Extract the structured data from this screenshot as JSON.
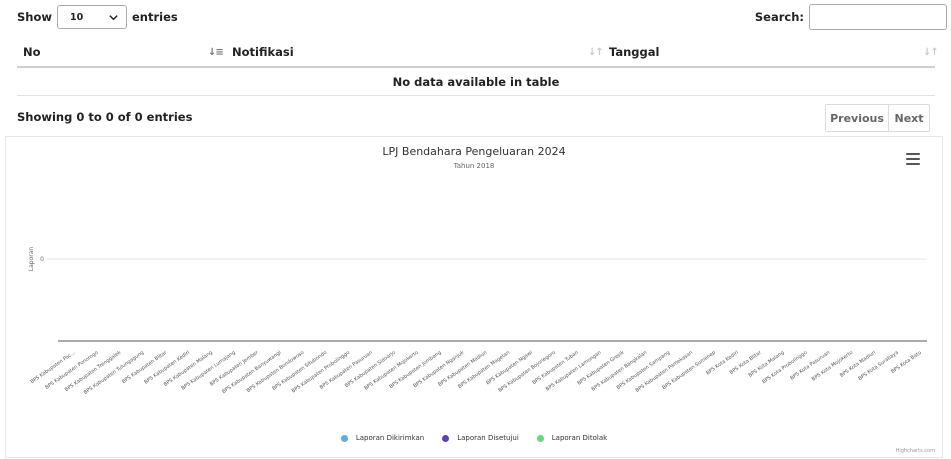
{
  "length_menu": {
    "show_label": "Show",
    "selected": "10",
    "entries_label": "entries"
  },
  "search": {
    "label": "Search:",
    "value": ""
  },
  "table": {
    "columns": [
      "No",
      "Notifikasi",
      "Tanggal"
    ],
    "empty_message": "No data available in table"
  },
  "info": "Showing 0 to 0 of 0 entries",
  "pagination": {
    "previous": "Previous",
    "next": "Next"
  },
  "chart_data": {
    "type": "bar",
    "title": "LPJ Bendahara Pengeluaran 2024",
    "subtitle": "Tahun 2018",
    "ylabel": "Laporan",
    "y_ticks": [
      "0"
    ],
    "categories": [
      "BPS Kabupaten Pac...",
      "BPS Kabupaten Ponorogo",
      "BPS Kabupaten Trenggalek",
      "BPS Kabupaten Tulungagung",
      "BPS Kabupaten Blitar",
      "BPS Kabupaten Kediri",
      "BPS Kabupaten Malang",
      "BPS Kabupaten Lumajang",
      "BPS Kabupaten Jember",
      "BPS Kabupaten Banyuwangi",
      "BPS Kabupaten Bondowoso",
      "BPS Kabupaten Situbondo",
      "BPS Kabupaten Probolinggo",
      "BPS Kabupaten Pasuruan",
      "BPS Kabupaten Sidoarjo",
      "BPS Kabupaten Mojokerto",
      "BPS Kabupaten Jombang",
      "BPS Kabupaten Nganjuk",
      "BPS Kabupaten Madiun",
      "BPS Kabupaten Magetan",
      "BPS Kabupaten Ngawi",
      "BPS Kabupaten Bojonegoro",
      "BPS Kabupaten Tuban",
      "BPS Kabupaten Lamongan",
      "BPS Kabupaten Gresik",
      "BPS Kabupaten Bangkalan",
      "BPS Kabupaten Sampang",
      "BPS Kabupaten Pamekasan",
      "BPS Kabupaten Sumenep",
      "BPS Kota Kediri",
      "BPS Kota Blitar",
      "BPS Kota Malang",
      "BPS Kota Probolinggo",
      "BPS Kota Pasuruan",
      "BPS Kota Mojokerto",
      "BPS Kota Madiun",
      "BPS Kota Surabaya",
      "BPS Kota Batu"
    ],
    "series": [
      {
        "name": "Laporan Dikirimkan",
        "color": "#5aaee6",
        "values": []
      },
      {
        "name": "Laporan Disetujui",
        "color": "#5b3fbf",
        "values": []
      },
      {
        "name": "Laporan Ditolak",
        "color": "#5fdc7d",
        "values": []
      }
    ],
    "credits": "Highcharts.com"
  }
}
